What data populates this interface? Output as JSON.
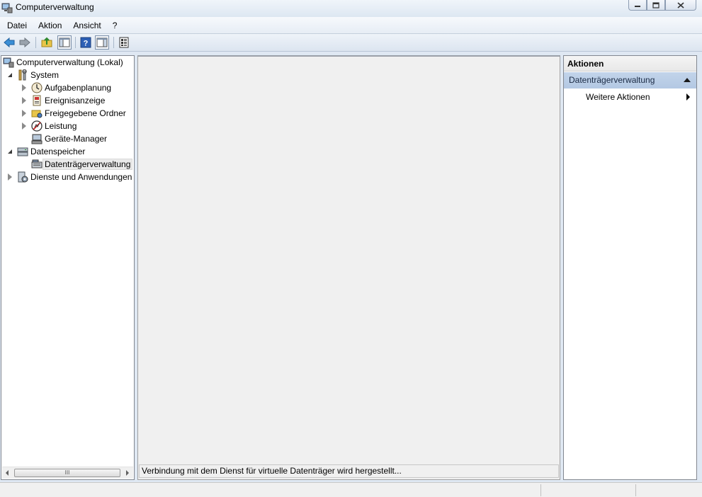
{
  "window": {
    "title": "Computerverwaltung",
    "buttons": [
      "minimize",
      "maximize",
      "close"
    ]
  },
  "menu": [
    "Datei",
    "Aktion",
    "Ansicht",
    "?"
  ],
  "toolbar": {
    "icons": [
      "back-arrow-icon",
      "forward-arrow-icon",
      "up-folder-icon",
      "show-hide-console-tree-icon",
      "help-icon",
      "show-hide-action-pane-icon",
      "properties-icon"
    ]
  },
  "tree": {
    "root": "Computerverwaltung (Lokal)",
    "system": "System",
    "aufgabenplanung": "Aufgabenplanung",
    "ereignisanzeige": "Ereignisanzeige",
    "freigegebene_ordner": "Freigegebene Ordner",
    "leistung": "Leistung",
    "geraete_manager": "Geräte-Manager",
    "datenspeicher": "Datenspeicher",
    "datentraegerverwaltung": "Datenträgerverwaltung",
    "dienste": "Dienste und Anwendungen"
  },
  "scrollbar": {
    "thumb_grip": "III"
  },
  "center": {
    "status_text": "Verbindung mit dem Dienst für virtuelle Datenträger wird hergestellt..."
  },
  "actions": {
    "header": "Aktionen",
    "section_title": "Datenträgerverwaltung",
    "more_actions": "Weitere Aktionen"
  },
  "colors": {
    "window_bg": "#dfe8f3",
    "action_section_bg": "#b9cde6",
    "center_bg": "#f0f0f0"
  }
}
